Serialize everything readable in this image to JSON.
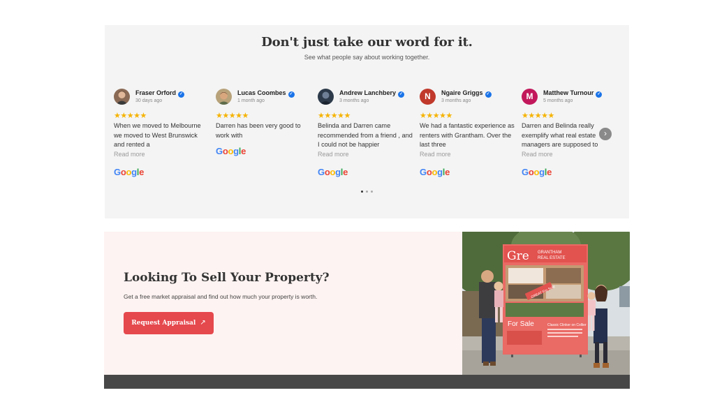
{
  "reviews": {
    "heading": "Don't just take our word for it.",
    "subheading": "See what people say about working together.",
    "stars": "★★★★★",
    "read_more": "Read more",
    "google_logo": [
      "G",
      "o",
      "o",
      "g",
      "l",
      "e"
    ],
    "items": [
      {
        "name": "Fraser Orford",
        "date": "30 days ago",
        "text": "When we moved to Melbourne we moved to West Brunswick and rented a",
        "avatar": "photo",
        "has_read_more": true
      },
      {
        "name": "Lucas Coombes",
        "date": "1 month ago",
        "text": "Darren has been very good to work with",
        "avatar": "photo",
        "has_read_more": false
      },
      {
        "name": "Andrew Lanchbery",
        "date": "3 months ago",
        "text": "Belinda and Darren came recommended from a friend , and I could not be happier",
        "avatar": "photo",
        "has_read_more": true
      },
      {
        "name": "Ngaire Griggs",
        "date": "3 months ago",
        "text": "We had a fantastic experience as renters with Grantham. Over the last three",
        "avatar": "N",
        "avatar_color": "#c0392b",
        "has_read_more": true
      },
      {
        "name": "Matthew Turnour",
        "date": "5 months ago",
        "text": "Darren and Belinda really exemplify what real estate managers are supposed to",
        "avatar": "M",
        "avatar_color": "#c2185b",
        "has_read_more": true
      }
    ],
    "next_icon": "›",
    "page_count": 3,
    "active_page": 1
  },
  "cta": {
    "heading": "Looking To Sell Your Property?",
    "body": "Get a free market appraisal and find out how much your property is worth.",
    "button_label": "Request Appraisal",
    "button_icon": "↗"
  },
  "photo": {
    "sign_logo": "Gre",
    "sign_brand_line1": "GRANTHAM",
    "sign_brand_line2": "REAL ESTATE",
    "sign_sold_ribbon": "GREAT Fro Sold",
    "sign_for_sale": "For Sale",
    "sign_subtitle": "Classic Clinker on Collier"
  },
  "colors": {
    "section_bg": "#f4f4f4",
    "cta_bg": "#fdf3f2",
    "button": "#e5484d",
    "star": "#f5b301",
    "verified": "#1a73e8",
    "footer": "#474747"
  }
}
